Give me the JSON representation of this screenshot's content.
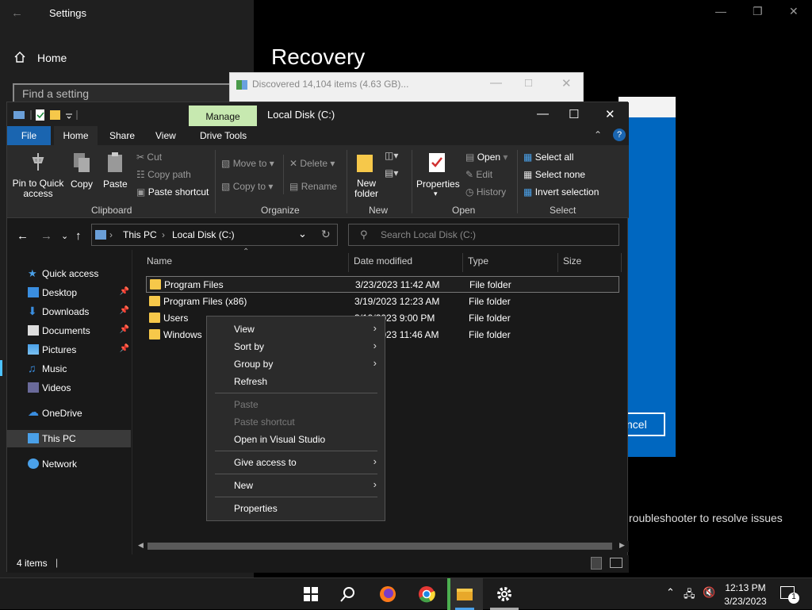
{
  "settings": {
    "title": "Settings",
    "home": "Home",
    "search_placeholder": "Find a setting",
    "heading": "Recovery",
    "cancel_label": "ncel",
    "troubleshooter_text": "roubleshooter to resolve issues"
  },
  "progress_dialog": {
    "text": "Discovered 14,104 items (4.63 GB)..."
  },
  "explorer": {
    "manage_tab": "Manage",
    "title": "Local Disk (C:)",
    "tabs": [
      "File",
      "Home",
      "Share",
      "View",
      "Drive Tools"
    ],
    "ribbon": {
      "clipboard": {
        "group": "Clipboard",
        "pin": "Pin to Quick access",
        "copy": "Copy",
        "paste": "Paste",
        "cut": "Cut",
        "copy_path": "Copy path",
        "paste_shortcut": "Paste shortcut"
      },
      "organize": {
        "group": "Organize",
        "move_to": "Move to",
        "copy_to": "Copy to",
        "delete": "Delete",
        "rename": "Rename"
      },
      "new": {
        "group": "New",
        "new_folder": "New folder"
      },
      "open": {
        "group": "Open",
        "properties": "Properties",
        "open": "Open",
        "edit": "Edit",
        "history": "History"
      },
      "select": {
        "group": "Select",
        "select_all": "Select all",
        "select_none": "Select none",
        "invert": "Invert selection"
      }
    },
    "address": {
      "crumb1": "This PC",
      "crumb2": "Local Disk (C:)",
      "search_placeholder": "Search Local Disk (C:)"
    },
    "nav": {
      "quick_access": "Quick access",
      "items": [
        {
          "label": "Desktop",
          "pinned": true
        },
        {
          "label": "Downloads",
          "pinned": true
        },
        {
          "label": "Documents",
          "pinned": true
        },
        {
          "label": "Pictures",
          "pinned": true
        },
        {
          "label": "Music",
          "pinned": false
        },
        {
          "label": "Videos",
          "pinned": false
        }
      ],
      "onedrive": "OneDrive",
      "this_pc": "This PC",
      "network": "Network"
    },
    "columns": [
      "Name",
      "Date modified",
      "Type",
      "Size"
    ],
    "files": [
      {
        "name": "Program Files",
        "date": "3/23/2023 11:42 AM",
        "type": "File folder"
      },
      {
        "name": "Program Files (x86)",
        "date": "3/19/2023 12:23 AM",
        "type": "File folder"
      },
      {
        "name": "Users",
        "date": "3/19/2023 9:00 PM",
        "type": "File folder"
      },
      {
        "name": "Windows",
        "date": "3/23/2023 11:46 AM",
        "type": "File folder"
      }
    ],
    "status": "4 items"
  },
  "context_menu": {
    "view": "View",
    "sort_by": "Sort by",
    "group_by": "Group by",
    "refresh": "Refresh",
    "paste": "Paste",
    "paste_shortcut": "Paste shortcut",
    "open_vs": "Open in Visual Studio",
    "give_access": "Give access to",
    "new": "New",
    "properties": "Properties"
  },
  "taskbar": {
    "time": "12:13 PM",
    "date": "3/23/2023",
    "notification_count": "1"
  },
  "colors": {
    "accent": "#0067c0",
    "file_tab": "#1a65b0",
    "manage_tab": "#c7e9b0",
    "folder": "#f6c84a"
  }
}
